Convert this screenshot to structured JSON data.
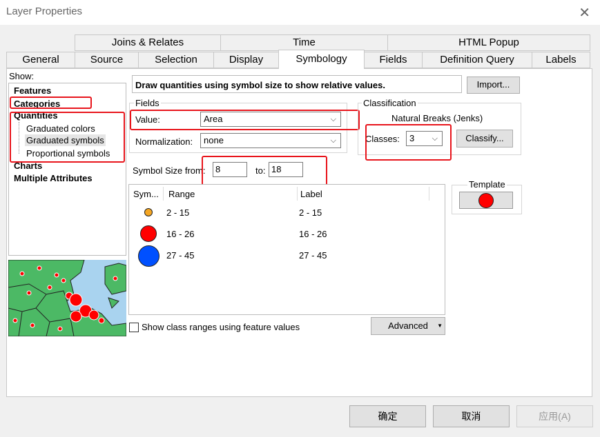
{
  "window": {
    "title": "Layer Properties",
    "close_glyph": "✕"
  },
  "tabs_row1": [
    "Joins & Relates",
    "Time",
    "HTML Popup"
  ],
  "tabs_row2": [
    "General",
    "Source",
    "Selection",
    "Display",
    "Symbology",
    "Fields",
    "Definition Query",
    "Labels"
  ],
  "active_tab": "Symbology",
  "show": {
    "label": "Show:",
    "items": [
      "Features",
      "Categories",
      "Quantities",
      "Graduated colors",
      "Graduated symbols",
      "Proportional symbols",
      "Charts",
      "Multiple Attributes"
    ]
  },
  "header": {
    "description": "Draw quantities using symbol size to show relative values.",
    "import_label": "Import..."
  },
  "fields": {
    "group_label": "Fields",
    "value_label": "Value:",
    "value": "Area",
    "normalization_label": "Normalization:",
    "normalization": "none"
  },
  "classification": {
    "group_label": "Classification",
    "method": "Natural Breaks (Jenks)",
    "classes_label": "Classes:",
    "classes": "3",
    "classify_label": "Classify..."
  },
  "symbol_size": {
    "from_label": "Symbol Size from:",
    "from": "8",
    "to_label": "to:",
    "to": "18"
  },
  "class_table": {
    "headers": [
      "Sym...",
      "Range",
      "Label"
    ],
    "rows": [
      {
        "range": "2 - 15",
        "label": "2 - 15",
        "color": "#f5a623"
      },
      {
        "range": "16 - 26",
        "label": "16 - 26",
        "color": "#ff0000"
      },
      {
        "range": "27 - 45",
        "label": "27 - 45",
        "color": "#0050ff"
      }
    ]
  },
  "template": {
    "label": "Template",
    "color": "#ff0000"
  },
  "show_ranges_label": "Show class ranges using feature values",
  "advanced_label": "Advanced",
  "buttons": {
    "ok": "确定",
    "cancel": "取消",
    "apply": "应用(A)"
  }
}
